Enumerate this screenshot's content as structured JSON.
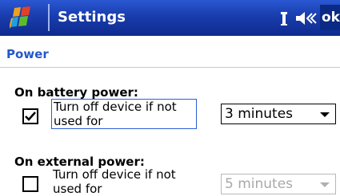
{
  "titlebar": {
    "title": "Settings",
    "ok_label": "ok"
  },
  "page": {
    "heading": "Power"
  },
  "battery": {
    "section_label": "On battery power:",
    "checkbox_label": "Turn off device if not used for",
    "checked": true,
    "dropdown_value": "3 minutes"
  },
  "external": {
    "section_label": "On external power:",
    "checkbox_label": "Turn off device if not used for",
    "checked": false,
    "dropdown_value": "5 minutes"
  },
  "colors": {
    "titlebar": "#1a3fb0",
    "heading": "#2458c8",
    "disabled_text": "#a8a8a8"
  },
  "icons": [
    "windows-start-icon",
    "connectivity-icon",
    "volume-icon",
    "dropdown-arrow-icon",
    "checkmark-icon"
  ]
}
